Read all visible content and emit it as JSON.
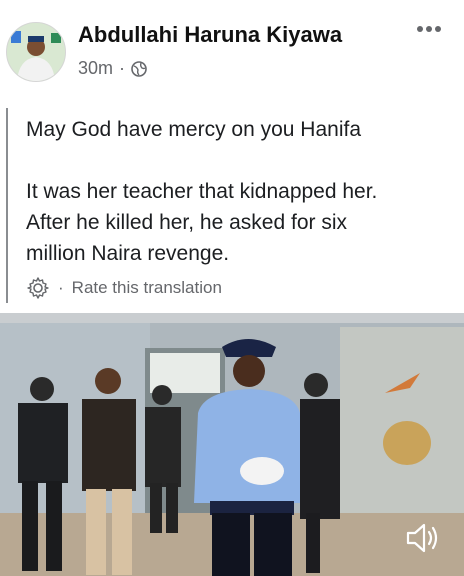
{
  "post": {
    "author": "Abdullahi Haruna Kiyawa",
    "time": "30m",
    "separator": "·",
    "lines": [
      "May God have mercy on you Hanifa",
      "It was her teacher that kidnapped her.",
      "After he killed her, he asked for six",
      "million Naira revenge."
    ],
    "translate_separator": "·",
    "translate_label": "Rate this translation"
  },
  "icons": {
    "privacy": "globe-icon",
    "options": "more-options-icon",
    "settings": "gear-icon",
    "volume": "speaker-icon"
  },
  "colors": {
    "text": "#1c1e21",
    "secondary": "#65676b",
    "police_uniform": "#8fb3e6"
  }
}
